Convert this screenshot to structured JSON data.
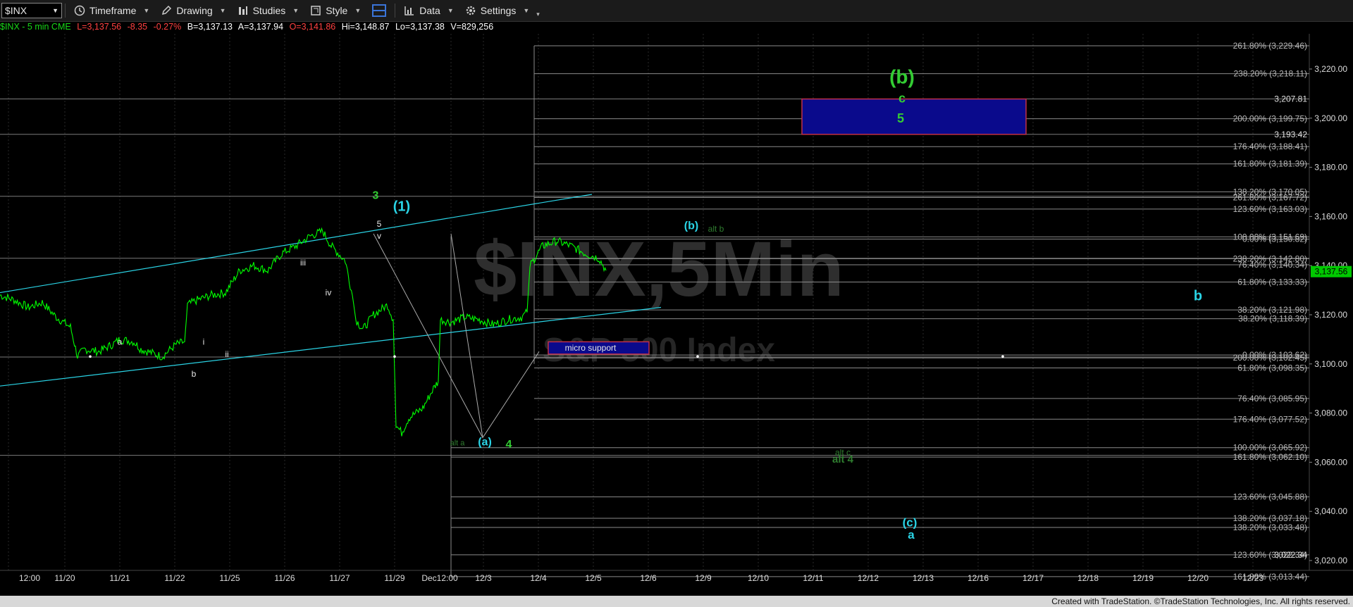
{
  "toolbar": {
    "symbol": "$INX",
    "timeframe": "Timeframe",
    "drawing": "Drawing",
    "studies": "Studies",
    "style": "Style",
    "data": "Data",
    "settings": "Settings"
  },
  "infobar": {
    "symbol": "$INX - 5 min  CME",
    "last": "L=3,137.56",
    "change": "-8.35",
    "pct": "-0.27%",
    "bid": "B=3,137.13",
    "ask": "A=3,137.94",
    "open": "O=3,141.86",
    "hi": "Hi=3,148.87",
    "lo": "Lo=3,137.38",
    "vol": "V=829,256"
  },
  "colors": {
    "price": "#00ff00",
    "cyan": "#2ad4e6",
    "green_label": "#33cc33",
    "dark_green": "#2f7d2f",
    "fib_line": "#8a8a8a",
    "box_fill": "#0a0a8c",
    "box_border": "#c0304a"
  },
  "watermark": {
    "symbol": "$INX,5Min",
    "name": "S&P 500 Index"
  },
  "footer": "Created with TradeStation. ©TradeStation Technologies, Inc. All rights reserved.",
  "chart_data": {
    "type": "line",
    "title": "$INX,5Min",
    "ylim": [
      3010,
      3234
    ],
    "y_ticks": [
      3020,
      3040,
      3060,
      3080,
      3100,
      3120,
      3140,
      3160,
      3180,
      3200,
      3220
    ],
    "y_tick_labels": [
      "3,020.00",
      "3,040.00",
      "3,060.00",
      "3,080.00",
      "3,100.00",
      "3,120.00",
      "3,140.00",
      "3,160.00",
      "3,180.00",
      "3,200.00",
      "3,220.00"
    ],
    "last_price": "3,137.56",
    "x_labels": [
      "12:00",
      "11/20",
      "11/21",
      "11/22",
      "11/25",
      "11/26",
      "11/27",
      "11/29",
      "Dec12:00",
      "12/3",
      "12/4",
      "12/5",
      "12/6",
      "12/9",
      "12/10",
      "12/11",
      "12/12",
      "12/13",
      "12/16",
      "12/17",
      "12/18",
      "12/19",
      "12/20",
      "12/23"
    ],
    "series": [
      {
        "values": [
          [
            0,
            3128
          ],
          [
            20,
            3126
          ],
          [
            40,
            3123
          ],
          [
            60,
            3125
          ],
          [
            80,
            3119
          ],
          [
            100,
            3115
          ],
          [
            110,
            3103
          ],
          [
            120,
            3106
          ],
          [
            140,
            3105
          ],
          [
            160,
            3108
          ],
          [
            170,
            3110
          ],
          [
            190,
            3109
          ],
          [
            200,
            3106
          ],
          [
            210,
            3105
          ],
          [
            230,
            3103
          ],
          [
            250,
            3108
          ],
          [
            262,
            3109
          ],
          [
            266,
            3124
          ],
          [
            280,
            3126
          ],
          [
            300,
            3128
          ],
          [
            320,
            3129
          ],
          [
            340,
            3138
          ],
          [
            360,
            3140
          ],
          [
            380,
            3138
          ],
          [
            400,
            3145
          ],
          [
            420,
            3148
          ],
          [
            440,
            3152
          ],
          [
            458,
            3154
          ],
          [
            470,
            3148
          ],
          [
            490,
            3142
          ],
          [
            500,
            3128
          ],
          [
            505,
            3118
          ],
          [
            515,
            3114
          ],
          [
            530,
            3120
          ],
          [
            550,
            3124
          ],
          [
            558,
            3118
          ],
          [
            562,
            3075
          ],
          [
            570,
            3072
          ],
          [
            580,
            3078
          ],
          [
            600,
            3082
          ],
          [
            615,
            3090
          ],
          [
            622,
            3093
          ],
          [
            625,
            3118
          ],
          [
            640,
            3117
          ],
          [
            660,
            3119
          ],
          [
            680,
            3118
          ],
          [
            700,
            3116
          ],
          [
            720,
            3118
          ],
          [
            740,
            3119
          ],
          [
            748,
            3121
          ],
          [
            752,
            3140
          ],
          [
            770,
            3148
          ],
          [
            790,
            3150
          ],
          [
            810,
            3148
          ],
          [
            830,
            3145
          ],
          [
            850,
            3143
          ],
          [
            860,
            3138
          ]
        ]
      }
    ],
    "fib_levels": [
      {
        "label": "261.80% (3,229.46)",
        "y": 3229.46
      },
      {
        "label": "238.20% (3,218.11)",
        "y": 3218.11
      },
      {
        "label": "200.00% (3,199.75)",
        "y": 3199.75
      },
      {
        "label": "176.40% (3,188.41)",
        "y": 3188.41
      },
      {
        "label": "161.80% (3,181.39)",
        "y": 3181.39
      },
      {
        "label": "138.20% (3,170.05)",
        "y": 3170.05
      },
      {
        "label": "261.80% (3,167.72)",
        "y": 3167.72
      },
      {
        "label": "123.60% (3,163.03)",
        "y": 3163.03
      },
      {
        "label": "100.00% (3,151.69)",
        "y": 3151.69
      },
      {
        "label": "0.00% (3,150.82)",
        "y": 3150.82
      },
      {
        "label": "238.20% (3,142.80)",
        "y": 3142.8
      },
      {
        "label": "76.40% (3,140.34)",
        "y": 3140.34
      },
      {
        "label": "61.80% (3,133.33)",
        "y": 3133.33
      },
      {
        "label": "38.20% (3,121.98)",
        "y": 3121.98
      },
      {
        "label": "38.20% (3,118.39)",
        "y": 3118.39
      },
      {
        "label": "0.00% (3,103.62)",
        "y": 3103.62
      },
      {
        "label": "200.00% (3,102.45)",
        "y": 3102.45
      },
      {
        "label": "61.80% (3,098.35)",
        "y": 3098.35
      },
      {
        "label": "76.40% (3,085.95)",
        "y": 3085.95
      },
      {
        "label": "176.40% (3,077.52)",
        "y": 3077.52
      },
      {
        "label": "100.00% (3,065.92)",
        "y": 3065.92
      },
      {
        "label": "161.80% (3,062.10)",
        "y": 3062.1
      },
      {
        "label": "123.60% (3,045.88)",
        "y": 3045.88
      },
      {
        "label": "138.20% (3,037.18)",
        "y": 3037.18
      },
      {
        "label": "138.20% (3,033.48)",
        "y": 3033.48
      },
      {
        "label": "123.60% (3,022.34)",
        "y": 3022.34
      },
      {
        "label": "161.80% (3,013.44)",
        "y": 3013.44
      }
    ],
    "price_lines": [
      {
        "label": "3,207.81",
        "y": 3207.81
      },
      {
        "label": "3,193.42",
        "y": 3193.42
      },
      {
        "label": "3,022.34",
        "y": 3022.34
      }
    ],
    "support_label": "micro support",
    "target_box_label": "5",
    "wave_labels": [
      {
        "text": "(b)",
        "color": "green_label",
        "size": "big"
      },
      {
        "text": "c",
        "color": "green_label"
      },
      {
        "text": "3",
        "color": "green_label"
      },
      {
        "text": "(1)",
        "color": "cyan"
      },
      {
        "text": "5",
        "color": "white"
      },
      {
        "text": "v",
        "color": "white"
      },
      {
        "text": "iii",
        "color": "white"
      },
      {
        "text": "iv",
        "color": "white"
      },
      {
        "text": "a",
        "color": "white"
      },
      {
        "text": "i",
        "color": "white"
      },
      {
        "text": "b",
        "color": "white"
      },
      {
        "text": "ii",
        "color": "white"
      },
      {
        "text": "(b)",
        "color": "cyan"
      },
      {
        "text": "alt b",
        "color": "dark_green"
      },
      {
        "text": "alt a",
        "color": "dark_green"
      },
      {
        "text": "(a)",
        "color": "cyan"
      },
      {
        "text": "4",
        "color": "green_label"
      },
      {
        "text": "alt c",
        "color": "dark_green"
      },
      {
        "text": "alt 4",
        "color": "dark_green"
      },
      {
        "text": "(c)",
        "color": "cyan"
      },
      {
        "text": "a",
        "color": "cyan"
      },
      {
        "text": "b",
        "color": "cyan"
      }
    ]
  }
}
